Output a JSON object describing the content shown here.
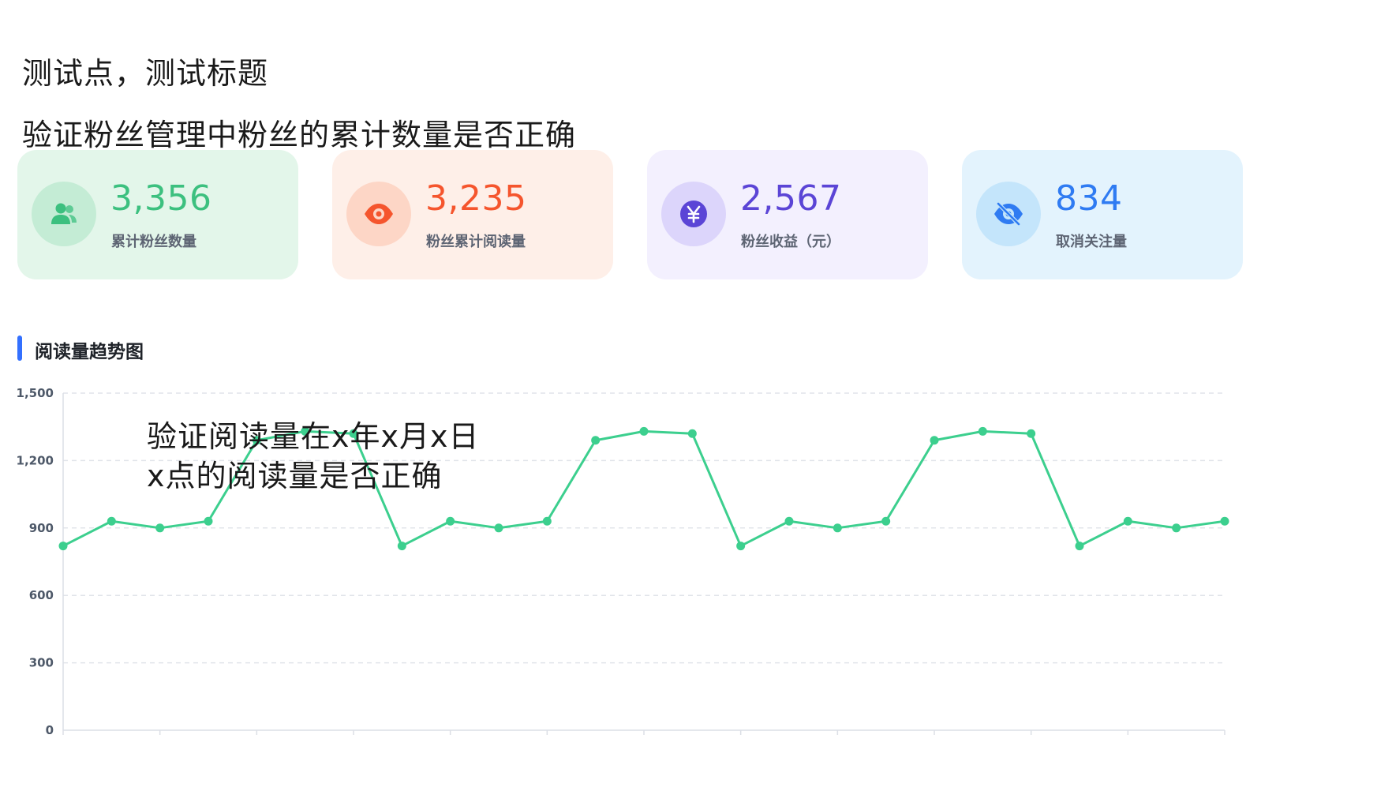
{
  "header": {
    "title": "测试点，测试标题",
    "subtitle": "验证粉丝管理中粉丝的累计数量是否正确"
  },
  "stats": [
    {
      "value": "3,356",
      "label": "累计粉丝数量",
      "icon": "users-icon",
      "color": "#3cc07f",
      "iconBg": "#c4ecd5",
      "bg": "#e3f6ea"
    },
    {
      "value": "3,235",
      "label": "粉丝累计阅读量",
      "icon": "eye-icon",
      "color": "#f5552d",
      "iconBg": "#fdd6c6",
      "bg": "#feefe8"
    },
    {
      "value": "2,567",
      "label": "粉丝收益（元）",
      "icon": "yuan-icon",
      "color": "#5b45d6",
      "iconBg": "#dcd5fb",
      "bg": "#f3f0fe"
    },
    {
      "value": "834",
      "label": "取消关注量",
      "icon": "eye-off-icon",
      "color": "#2f7bf2",
      "iconBg": "#c4e5fb",
      "bg": "#e3f3fd"
    }
  ],
  "chart_section": {
    "title": "阅读量趋势图"
  },
  "annotation": {
    "line1": "验证阅读量在x年x月x日",
    "line2": "x点的阅读量是否正确"
  },
  "chart_data": {
    "type": "line",
    "title": "",
    "xlabel": "",
    "ylabel": "",
    "ylim": [
      0,
      1500
    ],
    "yticks": [
      0,
      300,
      600,
      900,
      1200,
      1500
    ],
    "ytick_labels": [
      "0",
      "300",
      "600",
      "900",
      "1,200",
      "1,500"
    ],
    "grid": true,
    "color": "#3ccf8e",
    "series": [
      {
        "values": [
          820,
          930,
          900,
          930,
          1290,
          1330,
          1320,
          820,
          930,
          900,
          930,
          1290,
          1330,
          1320,
          820,
          930,
          900,
          930,
          1290,
          1330,
          1320,
          820,
          930,
          900,
          930
        ]
      }
    ]
  }
}
